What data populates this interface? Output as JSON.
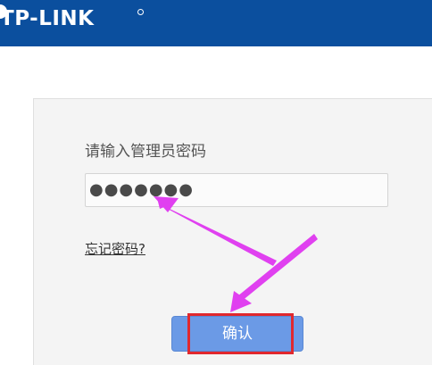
{
  "header": {
    "brand": "TP-LINK",
    "color": "#0b4f9e"
  },
  "login": {
    "prompt": "请输入管理员密码",
    "password_value": "●●●●●●●",
    "forgot_link": "忘记密码?",
    "confirm_label": "确认",
    "button_color": "#6b9ae6"
  },
  "annotations": {
    "arrow_color": "#e040f0",
    "highlight_color": "#e0282e"
  }
}
